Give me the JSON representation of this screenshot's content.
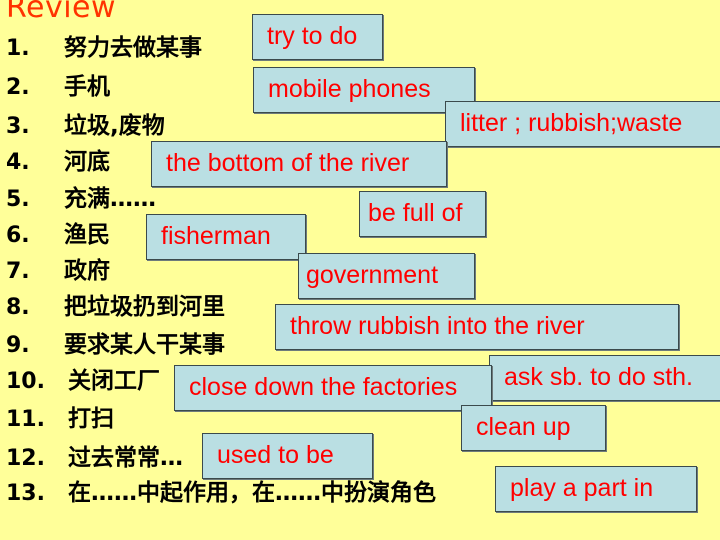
{
  "slide": {
    "title": "Review",
    "background_color": "#FFFF99",
    "answer_box_color": "#BADFE3",
    "answer_text_color": "#FF0000",
    "title_color": "#FF3300"
  },
  "items": [
    {
      "number": "1.",
      "chinese": "努力去做某事"
    },
    {
      "number": "2.",
      "chinese": "手机"
    },
    {
      "number": "3.",
      "chinese": "垃圾,废物"
    },
    {
      "number": "4.",
      "chinese": "河底"
    },
    {
      "number": "5.",
      "chinese": "充满……"
    },
    {
      "number": "6.",
      "chinese": "渔民"
    },
    {
      "number": "7.",
      "chinese": "政府"
    },
    {
      "number": "8.",
      "chinese": "把垃圾扔到河里"
    },
    {
      "number": "9.",
      "chinese": "要求某人干某事"
    },
    {
      "number": "10.",
      "chinese": "关闭工厂"
    },
    {
      "number": "11.",
      "chinese": "打扫"
    },
    {
      "number": "12.",
      "chinese": "过去常常…"
    },
    {
      "number": "13.",
      "chinese": "在……中起作用，在……中扮演角色"
    }
  ],
  "answers": {
    "a1": "try to do",
    "a2": "mobile phones",
    "a3": "litter ; rubbish;waste",
    "a4": "the bottom of the river",
    "a5": "be full of",
    "a6": "fisherman",
    "a7": "government",
    "a8": "throw rubbish into the river",
    "a9": "ask sb. to do sth.",
    "a10": "close down the factories",
    "a11": "clean up",
    "a12": "used to be",
    "a13": "play a part in"
  }
}
